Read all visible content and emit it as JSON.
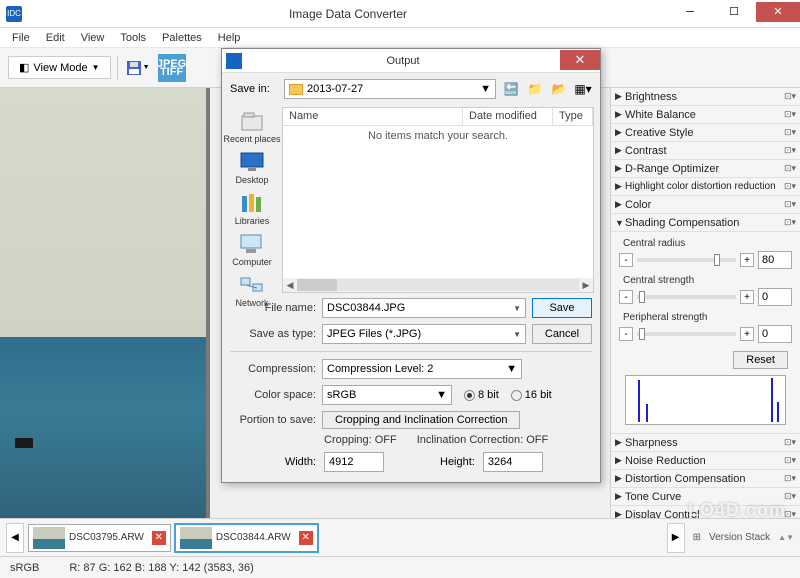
{
  "app": {
    "title": "Image Data Converter"
  },
  "menu": {
    "items": [
      "File",
      "Edit",
      "View",
      "Tools",
      "Palettes",
      "Help"
    ]
  },
  "toolbar": {
    "view_mode": "View Mode",
    "jpegtiff": "JPEG\nTIFF"
  },
  "dialog": {
    "title": "Output",
    "save_in_label": "Save in:",
    "folder": "2013-07-27",
    "columns": {
      "name": "Name",
      "date": "Date modified",
      "type": "Type"
    },
    "empty_msg": "No items match your search.",
    "filename_label": "File name:",
    "filename": "DSC03844.JPG",
    "saveas_label": "Save as type:",
    "saveas": "JPEG Files (*.JPG)",
    "save_btn": "Save",
    "cancel_btn": "Cancel",
    "compression_label": "Compression:",
    "compression": "Compression Level: 2",
    "colorspace_label": "Color space:",
    "colorspace": "sRGB",
    "bit8": "8 bit",
    "bit16": "16 bit",
    "portion_label": "Portion to save:",
    "crop_btn": "Cropping and Inclination Correction",
    "cropping": "Cropping: OFF",
    "inclination": "Inclination Correction:  OFF",
    "width_label": "Width:",
    "width": "4912",
    "height_label": "Height:",
    "height": "3264",
    "places": {
      "recent": "Recent places",
      "desktop": "Desktop",
      "libraries": "Libraries",
      "computer": "Computer",
      "network": "Network"
    }
  },
  "panel": {
    "brightness": "Brightness",
    "white_balance": "White Balance",
    "creative_style": "Creative Style",
    "contrast": "Contrast",
    "drange": "D-Range Optimizer",
    "highlight": "Highlight color distortion reduction",
    "color": "Color",
    "shading": "Shading Compensation",
    "central_radius": "Central radius",
    "central_radius_val": "80",
    "central_strength": "Central strength",
    "central_strength_val": "0",
    "peripheral_strength": "Peripheral strength",
    "peripheral_strength_val": "0",
    "reset": "Reset",
    "sharpness": "Sharpness",
    "noise": "Noise Reduction",
    "distortion": "Distortion Compensation",
    "tone_curve": "Tone Curve",
    "display_control": "Display Control"
  },
  "thumbs": {
    "t1": "DSC03795.ARW",
    "t2": "DSC03844.ARW",
    "version_stack": "Version Stack"
  },
  "status": {
    "cs": "sRGB",
    "rgb": "R:  87  G: 162  B: 188  Y: 142   (3583,   36)"
  },
  "watermark": "LO4D.com"
}
